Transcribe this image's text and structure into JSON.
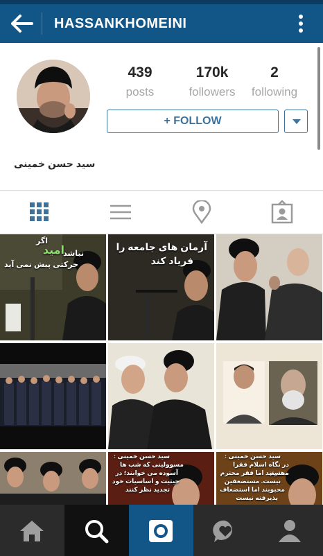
{
  "header": {
    "username": "HASSANKHOMEINI",
    "back_icon": "arrow-left-icon",
    "menu_icon": "more-vertical-icon"
  },
  "profile": {
    "posts": {
      "count": "439",
      "label": "posts"
    },
    "followers": {
      "count": "170k",
      "label": "followers"
    },
    "following": {
      "count": "2",
      "label": "following"
    },
    "follow_button": "+ FOLLOW",
    "full_name": "سید حسن خمینی"
  },
  "tabs": [
    "grid-icon",
    "list-icon",
    "location-pin-icon",
    "tagged-person-icon"
  ],
  "grid": {
    "post1_lines": [
      "اگر",
      "امید",
      "نباشد",
      "حرکتی پیش نمی آید"
    ],
    "post2_lines": [
      "آرمان های جامعه را",
      "فریاد کند"
    ],
    "post8_lines": [
      "سید حسن خمینی :",
      "مسوولینی که شب ها",
      "آسوده می خوابند؛ در",
      "حیثیت و اساسیات خود",
      "تجدید نظر کنند"
    ],
    "post9_lines": [
      "سید حسن خمینی :",
      "در نگاه اسلام فقرا محترم",
      "هستند اما فقر محترم",
      "نیست. مستضعفین",
      "محبوبند اما استضعاف",
      "پذیرفته نیست"
    ]
  },
  "bottom_nav": [
    "home-icon",
    "search-icon",
    "camera-icon",
    "activity-heart-icon",
    "profile-icon"
  ],
  "colors": {
    "header": "#125688",
    "follow": "#3f729b",
    "nav": "#2b2b2b"
  }
}
